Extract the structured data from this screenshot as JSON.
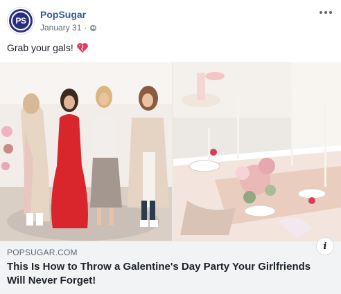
{
  "post": {
    "page_name": "PopSugar",
    "avatar_text": "PS",
    "date": "January 31",
    "dot": "·",
    "privacy_icon": "globe-icon",
    "more_icon": "more-options-icon",
    "message": "Grab your gals!",
    "message_emoji": "heart-icon"
  },
  "link": {
    "domain": "POPSUGAR.COM",
    "title": "This Is How to Throw a Galentine's Day Party Your Girlfriends Will Never Forget!",
    "info_label": "i"
  },
  "colors": {
    "page_name": "#385898",
    "avatar_bg": "#2a2e7e",
    "link_box_bg": "#f2f3f5",
    "heart": "#e8365f"
  }
}
